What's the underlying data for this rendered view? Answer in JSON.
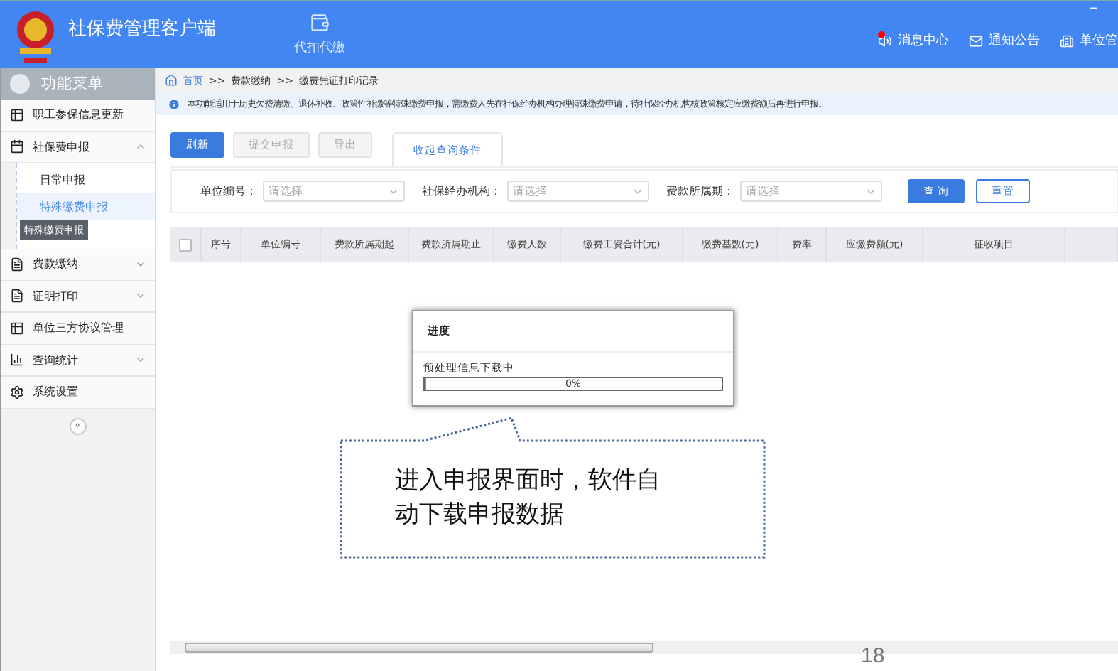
{
  "header": {
    "title": "社保费管理客户端",
    "module": "代扣代缴",
    "links": [
      {
        "label": "消息中心",
        "kind": "message",
        "unread": true
      },
      {
        "label": "通知公告",
        "kind": "notice"
      },
      {
        "label": "单位管",
        "kind": "unit"
      }
    ],
    "window_controls": [
      "−"
    ]
  },
  "sidebar": {
    "title": "功能菜单",
    "items": [
      {
        "label": "职工参保信息更新",
        "kind": "link"
      },
      {
        "label": "社保费申报",
        "kind": "group",
        "expanded": true,
        "children": [
          {
            "label": "日常申报",
            "selected": false
          },
          {
            "label": "特殊缴费申报",
            "selected": true
          }
        ]
      },
      {
        "label": "费款缴纳",
        "kind": "group",
        "expanded": false
      },
      {
        "label": "证明打印",
        "kind": "group",
        "expanded": false
      },
      {
        "label": "单位三方协议管理",
        "kind": "link"
      },
      {
        "label": "查询统计",
        "kind": "group",
        "expanded": false
      },
      {
        "label": "系统设置",
        "kind": "settings"
      }
    ],
    "tooltip": "特殊缴费申报",
    "collapse": "«"
  },
  "breadcrumb": {
    "separator": ">>",
    "items": [
      "首页",
      "费款缴纳",
      "缴费凭证打印记录"
    ]
  },
  "notice": "本功能适用于历史欠费清缴、退休补收、政策性补缴等特殊缴费申报，需缴费人先在社保经办机构办理特殊缴费申请，待社保经办机构核政策核定应缴费额后再进行申报。",
  "toolbar": {
    "buttons": [
      {
        "label": "刷新",
        "disabled": false
      },
      {
        "label": "提交申报",
        "disabled": true
      },
      {
        "label": "导出",
        "disabled": true
      }
    ],
    "tab": "收起查询条件"
  },
  "filters": [
    {
      "label": "单位编号：",
      "placeholder": "请选择"
    },
    {
      "label": "社保经办机构：",
      "placeholder": "请选择"
    },
    {
      "label": "费款所属期：",
      "placeholder": "请选择"
    }
  ],
  "filter_buttons": [
    {
      "label": "查 询",
      "kind": "primary"
    },
    {
      "label": "重置",
      "kind": "outline"
    }
  ],
  "table": {
    "select_all": false,
    "columns": [
      "序号",
      "单位编号",
      "费款所属期起",
      "费款所属期止",
      "缴费人数",
      "缴费工资合计(元)",
      "缴费基数(元)",
      "费率",
      "应缴费额(元)",
      "征收项目"
    ]
  },
  "dialog": {
    "title": "进度",
    "message": "预处理信息下载中",
    "level": 0,
    "reading": "0%"
  },
  "callout": "进入申报界面时，软件自动下载申报数据",
  "page_number": "18"
}
